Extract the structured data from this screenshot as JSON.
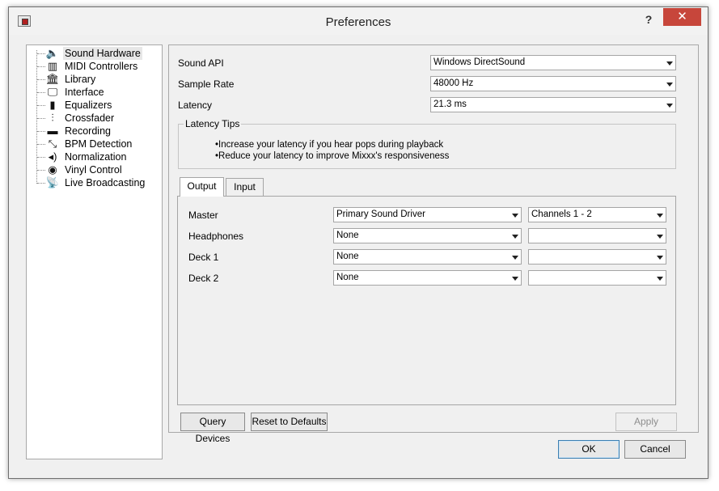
{
  "window": {
    "title": "Preferences",
    "help_label": "?",
    "close_label": "✕"
  },
  "sidebar": {
    "items": [
      {
        "label": "Sound Hardware",
        "icon": "speaker-icon",
        "glyph": "🔈"
      },
      {
        "label": "MIDI Controllers",
        "icon": "midi-keyboard-icon",
        "glyph": "▥"
      },
      {
        "label": "Library",
        "icon": "library-icon",
        "glyph": "🏛"
      },
      {
        "label": "Interface",
        "icon": "monitor-icon",
        "glyph": "🖵"
      },
      {
        "label": "Equalizers",
        "icon": "equalizer-icon",
        "glyph": "▮"
      },
      {
        "label": "Crossfader",
        "icon": "crossfader-icon",
        "glyph": "⫶"
      },
      {
        "label": "Recording",
        "icon": "recording-icon",
        "glyph": "▬"
      },
      {
        "label": "BPM Detection",
        "icon": "bpm-icon",
        "glyph": "⤡"
      },
      {
        "label": "Normalization",
        "icon": "normalization-icon",
        "glyph": "◂)"
      },
      {
        "label": "Vinyl Control",
        "icon": "vinyl-icon",
        "glyph": "◉"
      },
      {
        "label": "Live Broadcasting",
        "icon": "broadcast-icon",
        "glyph": "📡"
      }
    ]
  },
  "sound_api": {
    "label": "Sound API",
    "value": "Windows DirectSound"
  },
  "sample_rate": {
    "label": "Sample Rate",
    "value": "48000 Hz"
  },
  "latency": {
    "label": "Latency",
    "value": "21.3 ms"
  },
  "latency_tips": {
    "title": "Latency Tips",
    "tips": [
      "•Increase your latency if you hear pops during playback",
      "•Reduce your latency to improve Mixxx's responsiveness"
    ]
  },
  "tabs": {
    "output": "Output",
    "input": "Input"
  },
  "routing": [
    {
      "label": "Master",
      "device": "Primary Sound Driver",
      "channels": "Channels 1 - 2"
    },
    {
      "label": "Headphones",
      "device": "None",
      "channels": ""
    },
    {
      "label": "Deck 1",
      "device": "None",
      "channels": ""
    },
    {
      "label": "Deck 2",
      "device": "None",
      "channels": ""
    }
  ],
  "buttons": {
    "query_devices": "Query Devices",
    "reset_defaults": "Reset to Defaults",
    "apply": "Apply",
    "ok": "OK",
    "cancel": "Cancel"
  },
  "colors": {
    "close_button": "#c7463b",
    "window_bg": "#f0f0f0",
    "default_button_border": "#3c7fb1"
  }
}
